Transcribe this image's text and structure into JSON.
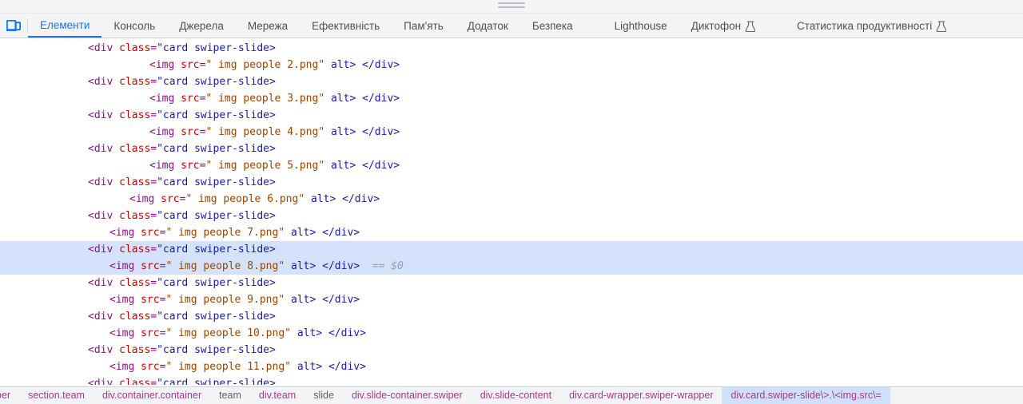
{
  "window": {
    "drag_handle_name": "panel-resize-handle"
  },
  "toolbar": {
    "device_toolbar_icon": "device-toolbar-icon",
    "device_toolbar_label": "Toggle device toolbar",
    "accent_color": "#1a73e8"
  },
  "tabs": [
    {
      "label": "Елементи",
      "active": true,
      "experimental": false,
      "group_gap": false
    },
    {
      "label": "Консоль",
      "active": false,
      "experimental": false,
      "group_gap": false
    },
    {
      "label": "Джерела",
      "active": false,
      "experimental": false,
      "group_gap": false
    },
    {
      "label": "Мережа",
      "active": false,
      "experimental": false,
      "group_gap": false
    },
    {
      "label": "Ефективність",
      "active": false,
      "experimental": false,
      "group_gap": false
    },
    {
      "label": "Пам'ять",
      "active": false,
      "experimental": false,
      "group_gap": false
    },
    {
      "label": "Додаток",
      "active": false,
      "experimental": false,
      "group_gap": false
    },
    {
      "label": "Безпека",
      "active": false,
      "experimental": false,
      "group_gap": false
    },
    {
      "label": "Lighthouse",
      "active": false,
      "experimental": false,
      "group_gap": true
    },
    {
      "label": "Диктофон",
      "active": false,
      "experimental": true,
      "group_gap": false
    },
    {
      "label": "Статистика продуктивності",
      "active": false,
      "experimental": true,
      "group_gap": true
    }
  ],
  "icons": {
    "flask": "experimental-flask-icon",
    "device": "device-toolbar-icon"
  },
  "code": {
    "selected_suffix": "== $0",
    "lines": [
      {
        "indent": 110,
        "type": "open",
        "tag": "div",
        "attr": "class",
        "value": "\"card swiper-slide>",
        "selected": false
      },
      {
        "indent": 187,
        "type": "img",
        "tag": "img",
        "attr": "src",
        "value": "\" img people 2.png\"",
        "tail": "alt> </div>",
        "selected": false
      },
      {
        "indent": 110,
        "type": "open",
        "tag": "div",
        "attr": "class",
        "value": "\"card swiper-slide>",
        "selected": false
      },
      {
        "indent": 187,
        "type": "img",
        "tag": "img",
        "attr": "src",
        "value": "\" img people 3.png\"",
        "tail": "alt> </div>",
        "selected": false
      },
      {
        "indent": 110,
        "type": "open",
        "tag": "div",
        "attr": "class",
        "value": "\"card swiper-slide>",
        "selected": false
      },
      {
        "indent": 187,
        "type": "img",
        "tag": "img",
        "attr": "src",
        "value": "\" img people 4.png\"",
        "tail": "alt> </div>",
        "selected": false
      },
      {
        "indent": 110,
        "type": "open",
        "tag": "div",
        "attr": "class",
        "value": "\"card swiper-slide>",
        "selected": false
      },
      {
        "indent": 187,
        "type": "img",
        "tag": "img",
        "attr": "src",
        "value": "\" img people 5.png\"",
        "tail": "alt> </div>",
        "selected": false
      },
      {
        "indent": 110,
        "type": "open",
        "tag": "div",
        "attr": "class",
        "value": "\"card swiper-slide>",
        "selected": false
      },
      {
        "indent": 162,
        "type": "img",
        "tag": "img",
        "attr": "src",
        "value": "\" img people 6.png\"",
        "tail": "alt> </div>",
        "selected": false
      },
      {
        "indent": 110,
        "type": "open",
        "tag": "div",
        "attr": "class",
        "value": "\"card swiper-slide>",
        "selected": false
      },
      {
        "indent": 137,
        "type": "img",
        "tag": "img",
        "attr": "src",
        "value": "\" img people 7.png\"",
        "tail": "alt> </div>",
        "selected": false
      },
      {
        "indent": 110,
        "type": "open",
        "tag": "div",
        "attr": "class",
        "value": "\"card swiper-slide>",
        "selected": true
      },
      {
        "indent": 137,
        "type": "img",
        "tag": "img",
        "attr": "src",
        "value": "\" img people 8.png\"",
        "tail": "alt> </div>",
        "selected": true,
        "suffix": "== $0"
      },
      {
        "indent": 110,
        "type": "open",
        "tag": "div",
        "attr": "class",
        "value": "\"card swiper-slide>",
        "selected": false
      },
      {
        "indent": 137,
        "type": "img",
        "tag": "img",
        "attr": "src",
        "value": "\" img people 9.png\"",
        "tail": "alt> </div>",
        "selected": false
      },
      {
        "indent": 110,
        "type": "open",
        "tag": "div",
        "attr": "class",
        "value": "\"card swiper-slide>",
        "selected": false
      },
      {
        "indent": 137,
        "type": "img",
        "tag": "img",
        "attr": "src",
        "value": "\" img people 10.png\"",
        "tail": "alt> </div>",
        "selected": false
      },
      {
        "indent": 110,
        "type": "open",
        "tag": "div",
        "attr": "class",
        "value": "\"card swiper-slide>",
        "selected": false
      },
      {
        "indent": 137,
        "type": "img",
        "tag": "img",
        "attr": "src",
        "value": "\" img people 11.png\"",
        "tail": "alt> </div>",
        "selected": false
      },
      {
        "indent": 110,
        "type": "open",
        "tag": "div",
        "attr": "class",
        "value": "\"card swiper-slide>",
        "selected": false,
        "clipped": true
      }
    ]
  },
  "breadcrumbs": [
    {
      "label": "per",
      "selected": false,
      "plain": false
    },
    {
      "label": "section.team",
      "selected": false,
      "plain": false
    },
    {
      "label": "div.container.container",
      "selected": false,
      "plain": false
    },
    {
      "label": "team",
      "selected": false,
      "plain": true
    },
    {
      "label": "div.team",
      "selected": false,
      "plain": false
    },
    {
      "label": "slide",
      "selected": false,
      "plain": true
    },
    {
      "label": "div.slide-container.swiper",
      "selected": false,
      "plain": false
    },
    {
      "label": "div.slide-content",
      "selected": false,
      "plain": false
    },
    {
      "label": "div.card-wrapper.swiper-wrapper",
      "selected": false,
      "plain": false
    },
    {
      "label": "div.card.swiper-slide\\>.\\<img.src\\=",
      "selected": true,
      "plain": false
    }
  ],
  "colors": {
    "selection_blue": "#d4e2fc",
    "crumb_selection": "#cfe0fb",
    "chrome_bg": "#f3f4f6",
    "tag_purple": "#881280",
    "attr_red": "#c80000",
    "value_blue": "#1a1aa6",
    "text_brown": "#994500"
  }
}
